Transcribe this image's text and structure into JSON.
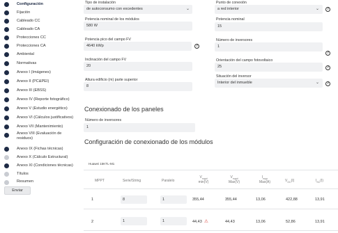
{
  "sidebar": {
    "items": [
      {
        "label": "Configuración",
        "active": true
      },
      {
        "label": "Fijación"
      },
      {
        "label": "Cableado CC"
      },
      {
        "label": "Cableado CA"
      },
      {
        "label": "Protecciones CC"
      },
      {
        "label": "Protecciones CA"
      },
      {
        "label": "Ambiental"
      },
      {
        "label": "Normativas"
      },
      {
        "label": "Anexo I (Imágenes)"
      },
      {
        "label": "Anexo II (PC&PEI)"
      },
      {
        "label": "Anexo III (EBSS)"
      },
      {
        "label": "Anexo IV (Reporte fotográfico)"
      },
      {
        "label": "Anexo V (Estudio energético)"
      },
      {
        "label": "Anexo VI (Cálculos justificativos)"
      },
      {
        "label": "Anexo VII (Mantenimiento)"
      },
      {
        "label": "Anexo VIII (Evaluación de residuos)"
      },
      {
        "label": "Anexo IX (Fichas técnicas)"
      },
      {
        "label": "Anexo X (Cálculo Estructural)"
      },
      {
        "label": "Anexo XI (Condiciones técnicas)"
      },
      {
        "label": "Títulos"
      },
      {
        "label": "Resumen"
      }
    ],
    "send_label": "Enviar"
  },
  "form": {
    "installation_type": {
      "label": "Tipo de instalación",
      "value": "de autoconsumo con excedentes"
    },
    "nominal_power_modules": {
      "label": "Potencia nominal de los módulos",
      "value": "580 W"
    },
    "peak_power_field": {
      "label": "Potencia pico del campo FV",
      "value": "4640 kWp"
    },
    "field_inclination": {
      "label": "Inclinación del campo FV",
      "value": "20"
    },
    "building_height": {
      "label": "Altura edificio (m) parte superior",
      "value": "8"
    },
    "connection_point": {
      "label": "Punto de conexión",
      "value": "a red interior"
    },
    "nominal_power": {
      "label": "Potencia nominal",
      "value": "15"
    },
    "inverter_count": {
      "label": "Número de inversores",
      "value": "1"
    },
    "orientation": {
      "label": "Orientación del campo fotovoltaico",
      "value": "25"
    },
    "inverter_location": {
      "label": "Situación del inversor",
      "value": "Interior del inmueble"
    }
  },
  "panels_section": {
    "title": "Conexionado de los paneles",
    "inverter_count_label": "Número de inversores",
    "inverter_count_value": "1"
  },
  "modules_section": {
    "title": "Configuración de conexionado de los módulos",
    "inverter_model": "Huawei 15KTL-M1",
    "columns": {
      "mppt": "MPPT",
      "series_string": "Serie/String",
      "parallel": "Paralelo",
      "vmppt_min": "Vmppt min(V)",
      "vmppt_max": "Vmppt max(V)",
      "impp_max": "Impp max(A)",
      "voc": "VOC(I)",
      "isc": "ISC(I)"
    },
    "rows": [
      {
        "mppt": "1",
        "series": "8",
        "parallel": "1",
        "vmin": "355,44",
        "vmax": "355,44",
        "impp": "13,06",
        "voc": "422,88",
        "isc": "13,91",
        "warning": false
      },
      {
        "mppt": "2",
        "series": "1",
        "parallel": "1",
        "vmin": "44,43",
        "vmax": "44,43",
        "impp": "13,06",
        "voc": "52,86",
        "isc": "13,91",
        "warning": true
      }
    ]
  }
}
